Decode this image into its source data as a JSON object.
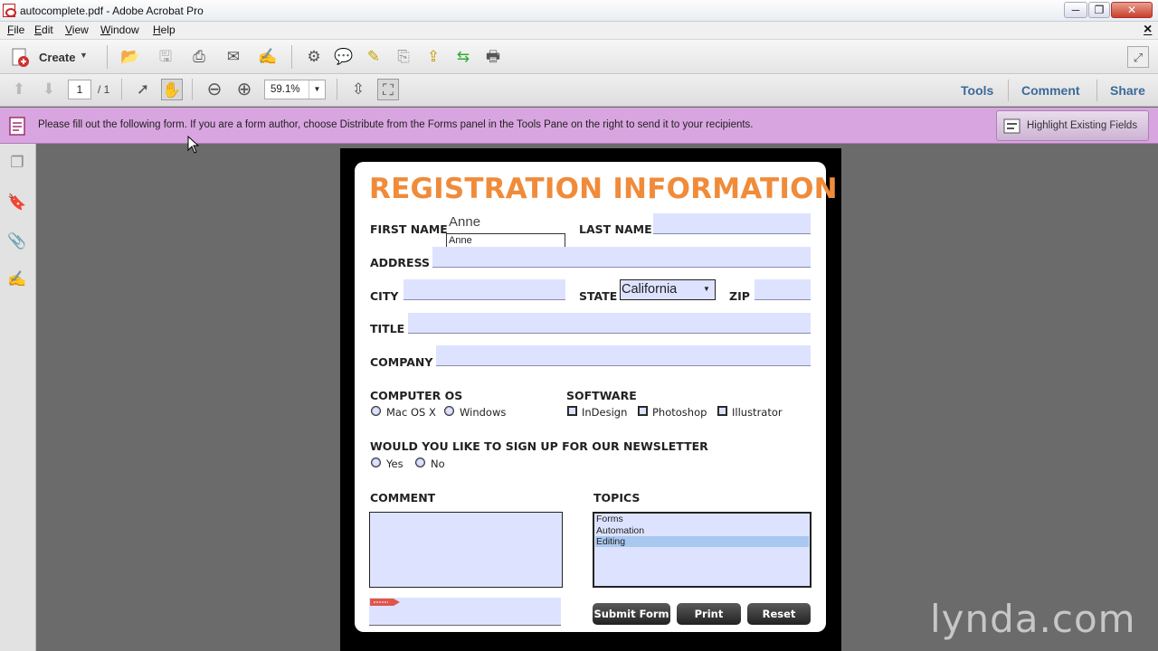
{
  "window": {
    "title": "autocomplete.pdf - Adobe Acrobat Pro",
    "minimize": "─",
    "restore": "❐",
    "close": "✕"
  },
  "menubar": {
    "items": [
      "File",
      "Edit",
      "View",
      "Window",
      "Help"
    ],
    "close": "×"
  },
  "toolbar1": {
    "create_label": "Create",
    "icons": [
      "open-icon",
      "save-icon",
      "print-icon",
      "email-icon",
      "sign-icon",
      "settings-icon",
      "comment-icon",
      "highlight-icon",
      "attach-icon",
      "export-icon",
      "combine-icon",
      "scan-icon"
    ]
  },
  "toolbar2": {
    "page_current": "1",
    "page_total": "/ 1",
    "zoom": "59.1%",
    "right_links": [
      "Tools",
      "Comment",
      "Share"
    ]
  },
  "infobar": {
    "message": "Please fill out the following form. If you are a form author, choose Distribute from the Forms panel in the Tools Pane on the right to send it to your recipients.",
    "highlight_button": "Highlight Existing Fields"
  },
  "form": {
    "title": "REGISTRATION INFORMATION",
    "title_color": "#f08b3a",
    "labels": {
      "first_name": "FIRST NAME",
      "last_name": "LAST NAME",
      "address": "ADDRESS",
      "city": "CITY",
      "state": "STATE",
      "zip": "ZIP",
      "title": "TITLE",
      "company": "COMPANY",
      "computer_os": "COMPUTER OS",
      "software": "SOFTWARE",
      "newsletter": "WOULD YOU LIKE TO SIGN UP FOR OUR NEWSLETTER",
      "comment": "COMMENT",
      "topics": "TOPICS"
    },
    "first_name_value": "Anne",
    "autocomplete_suggestion": "Anne",
    "state_value": "California",
    "os_options": [
      "Mac OS X",
      "Windows"
    ],
    "software_options": [
      "InDesign",
      "Photoshop",
      "Illustrator"
    ],
    "newsletter_options": [
      "Yes",
      "No"
    ],
    "topics": [
      "Forms",
      "Automation",
      "Editing"
    ],
    "topics_selected": "Editing",
    "buttons": {
      "submit": "Submit Form",
      "print": "Print",
      "reset": "Reset"
    }
  },
  "watermark": "lynda.com"
}
